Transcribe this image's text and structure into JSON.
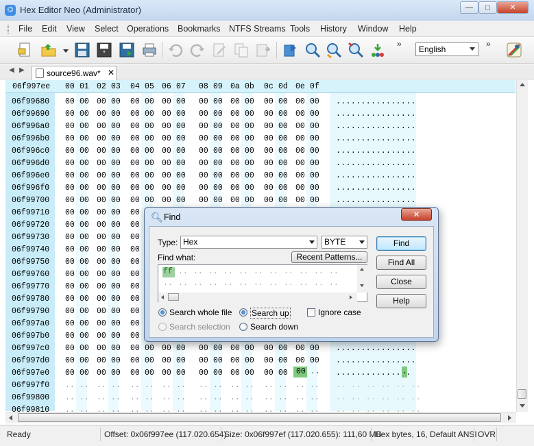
{
  "window": {
    "title": "Hex Editor Neo (Administrator)",
    "minimize": "—",
    "maximize": "□",
    "close": "✕"
  },
  "menu": [
    "File",
    "Edit",
    "View",
    "Select",
    "Operations",
    "Bookmarks",
    "NTFS Streams",
    "Tools",
    "History",
    "Window",
    "Help"
  ],
  "toolbar": {
    "language": "English",
    "overflow": "»"
  },
  "tabs": {
    "nav_left": "◀",
    "nav_right": "▶",
    "file_tab": "source96.wav*",
    "close": "✕"
  },
  "hex_header": {
    "offset": "06f997ee",
    "columns": [
      "00",
      "01",
      "02",
      "03",
      "04",
      "05",
      "06",
      "07",
      "08",
      "09",
      "0a",
      "0b",
      "0c",
      "0d",
      "0e",
      "0f"
    ]
  },
  "rows": [
    {
      "offset": "06f99680",
      "bytes": "00 00 00 00 00 00 00 00 00 00 00 00 00 00 00 00",
      "ascii": "................"
    },
    {
      "offset": "06f99690",
      "bytes": "00 00 00 00 00 00 00 00 00 00 00 00 00 00 00 00",
      "ascii": "................"
    },
    {
      "offset": "06f996a0",
      "bytes": "00 00 00 00 00 00 00 00 00 00 00 00 00 00 00 00",
      "ascii": "................"
    },
    {
      "offset": "06f996b0",
      "bytes": "00 00 00 00 00 00 00 00 00 00 00 00 00 00 00 00",
      "ascii": "................"
    },
    {
      "offset": "06f996c0",
      "bytes": "00 00 00 00 00 00 00 00 00 00 00 00 00 00 00 00",
      "ascii": "................"
    },
    {
      "offset": "06f996d0",
      "bytes": "00 00 00 00 00 00 00 00 00 00 00 00 00 00 00 00",
      "ascii": "................"
    },
    {
      "offset": "06f996e0",
      "bytes": "00 00 00 00 00 00 00 00 00 00 00 00 00 00 00 00",
      "ascii": "................"
    },
    {
      "offset": "06f996f0",
      "bytes": "00 00 00 00 00 00 00 00 00 00 00 00 00 00 00 00",
      "ascii": "................"
    },
    {
      "offset": "06f99700",
      "bytes": "00 00 00 00 00 00 00 00 00 00 00 00 00 00 00 00",
      "ascii": "................"
    },
    {
      "offset": "06f99710",
      "bytes": "00 00 00 00 00 00 00 00 00 00 00 00 00 00 00 00",
      "ascii": "................"
    },
    {
      "offset": "06f99720",
      "bytes": "00 00 00 00 00 00 00 00 00 00 00 00 00 00 00 00",
      "ascii": "................"
    },
    {
      "offset": "06f99730",
      "bytes": "00 00 00 00 00 00 00 00 00 00 00 00 00 00 00 00",
      "ascii": "................"
    },
    {
      "offset": "06f99740",
      "bytes": "00 00 00 00 00 00 00 00 00 00 00 00 00 00 00 00",
      "ascii": "................"
    },
    {
      "offset": "06f99750",
      "bytes": "00 00 00 00 00 00 00 00 00 00 00 00 00 00 00 00",
      "ascii": "................"
    },
    {
      "offset": "06f99760",
      "bytes": "00 00 00 00 00 00 00 00 00 00 00 00 00 00 00 00",
      "ascii": "................"
    },
    {
      "offset": "06f99770",
      "bytes": "00 00 00 00 00 00 00 00 00 00 00 00 00 00 00 00",
      "ascii": "................"
    },
    {
      "offset": "06f99780",
      "bytes": "00 00 00 00 00 00 00 00 00 00 00 00 00 00 00 00",
      "ascii": "................"
    },
    {
      "offset": "06f99790",
      "bytes": "00 00 00 00 00 00 00 00 00 00 00 00 00 00 00 00",
      "ascii": "................"
    },
    {
      "offset": "06f997a0",
      "bytes": "00 00 00 00 00 00 00 00 00 00 00 00 00 00 00 00",
      "ascii": "................"
    },
    {
      "offset": "06f997b0",
      "bytes": "00 00 00 00 00 00 00 00 00 00 00 00 00 00 00 00",
      "ascii": "................"
    },
    {
      "offset": "06f997c0",
      "bytes": "00 00 00 00 00 00 00 00 00 00 00 00 00 00 00 00",
      "ascii": "................"
    },
    {
      "offset": "06f997d0",
      "bytes": "00 00 00 00 00 00 00 00 00 00 00 00 00 00 00 00",
      "ascii": "................"
    },
    {
      "offset": "06f997e0",
      "bytes": "00 00 00 00 00 00 00 00 00 00 00 00 00 00 00",
      "ascii": "..............."
    },
    {
      "offset": "06f997f0",
      "bytes": "",
      "ascii": ""
    },
    {
      "offset": "06f99800",
      "bytes": "",
      "ascii": ""
    },
    {
      "offset": "06f99810",
      "bytes": "",
      "ascii": ""
    }
  ],
  "hex_tail": {
    "selected_byte": "00",
    "selected_ascii": "."
  },
  "status": {
    "state": "Ready",
    "offset": "Offset: 0x06f997ee (117.020.654)",
    "size": "Size: 0x06f997ef (117.020.655): 111,60 MB",
    "mode": "Hex bytes, 16, Default ANSI",
    "insert": "OVR"
  },
  "find": {
    "title": "Find",
    "type_label": "Type:",
    "type_value": "Hex",
    "width_value": "BYTE",
    "find_what_label": "Find what:",
    "recent_button": "Recent Patterns...",
    "pattern_first": "ff",
    "find_button": "Find",
    "find_all_button": "Find All",
    "close_button": "Close",
    "help_button": "Help",
    "search_whole_file": "Search whole file",
    "search_selection": "Search selection",
    "search_up": "Search up",
    "search_down": "Search down",
    "ignore_case": "Ignore case"
  }
}
